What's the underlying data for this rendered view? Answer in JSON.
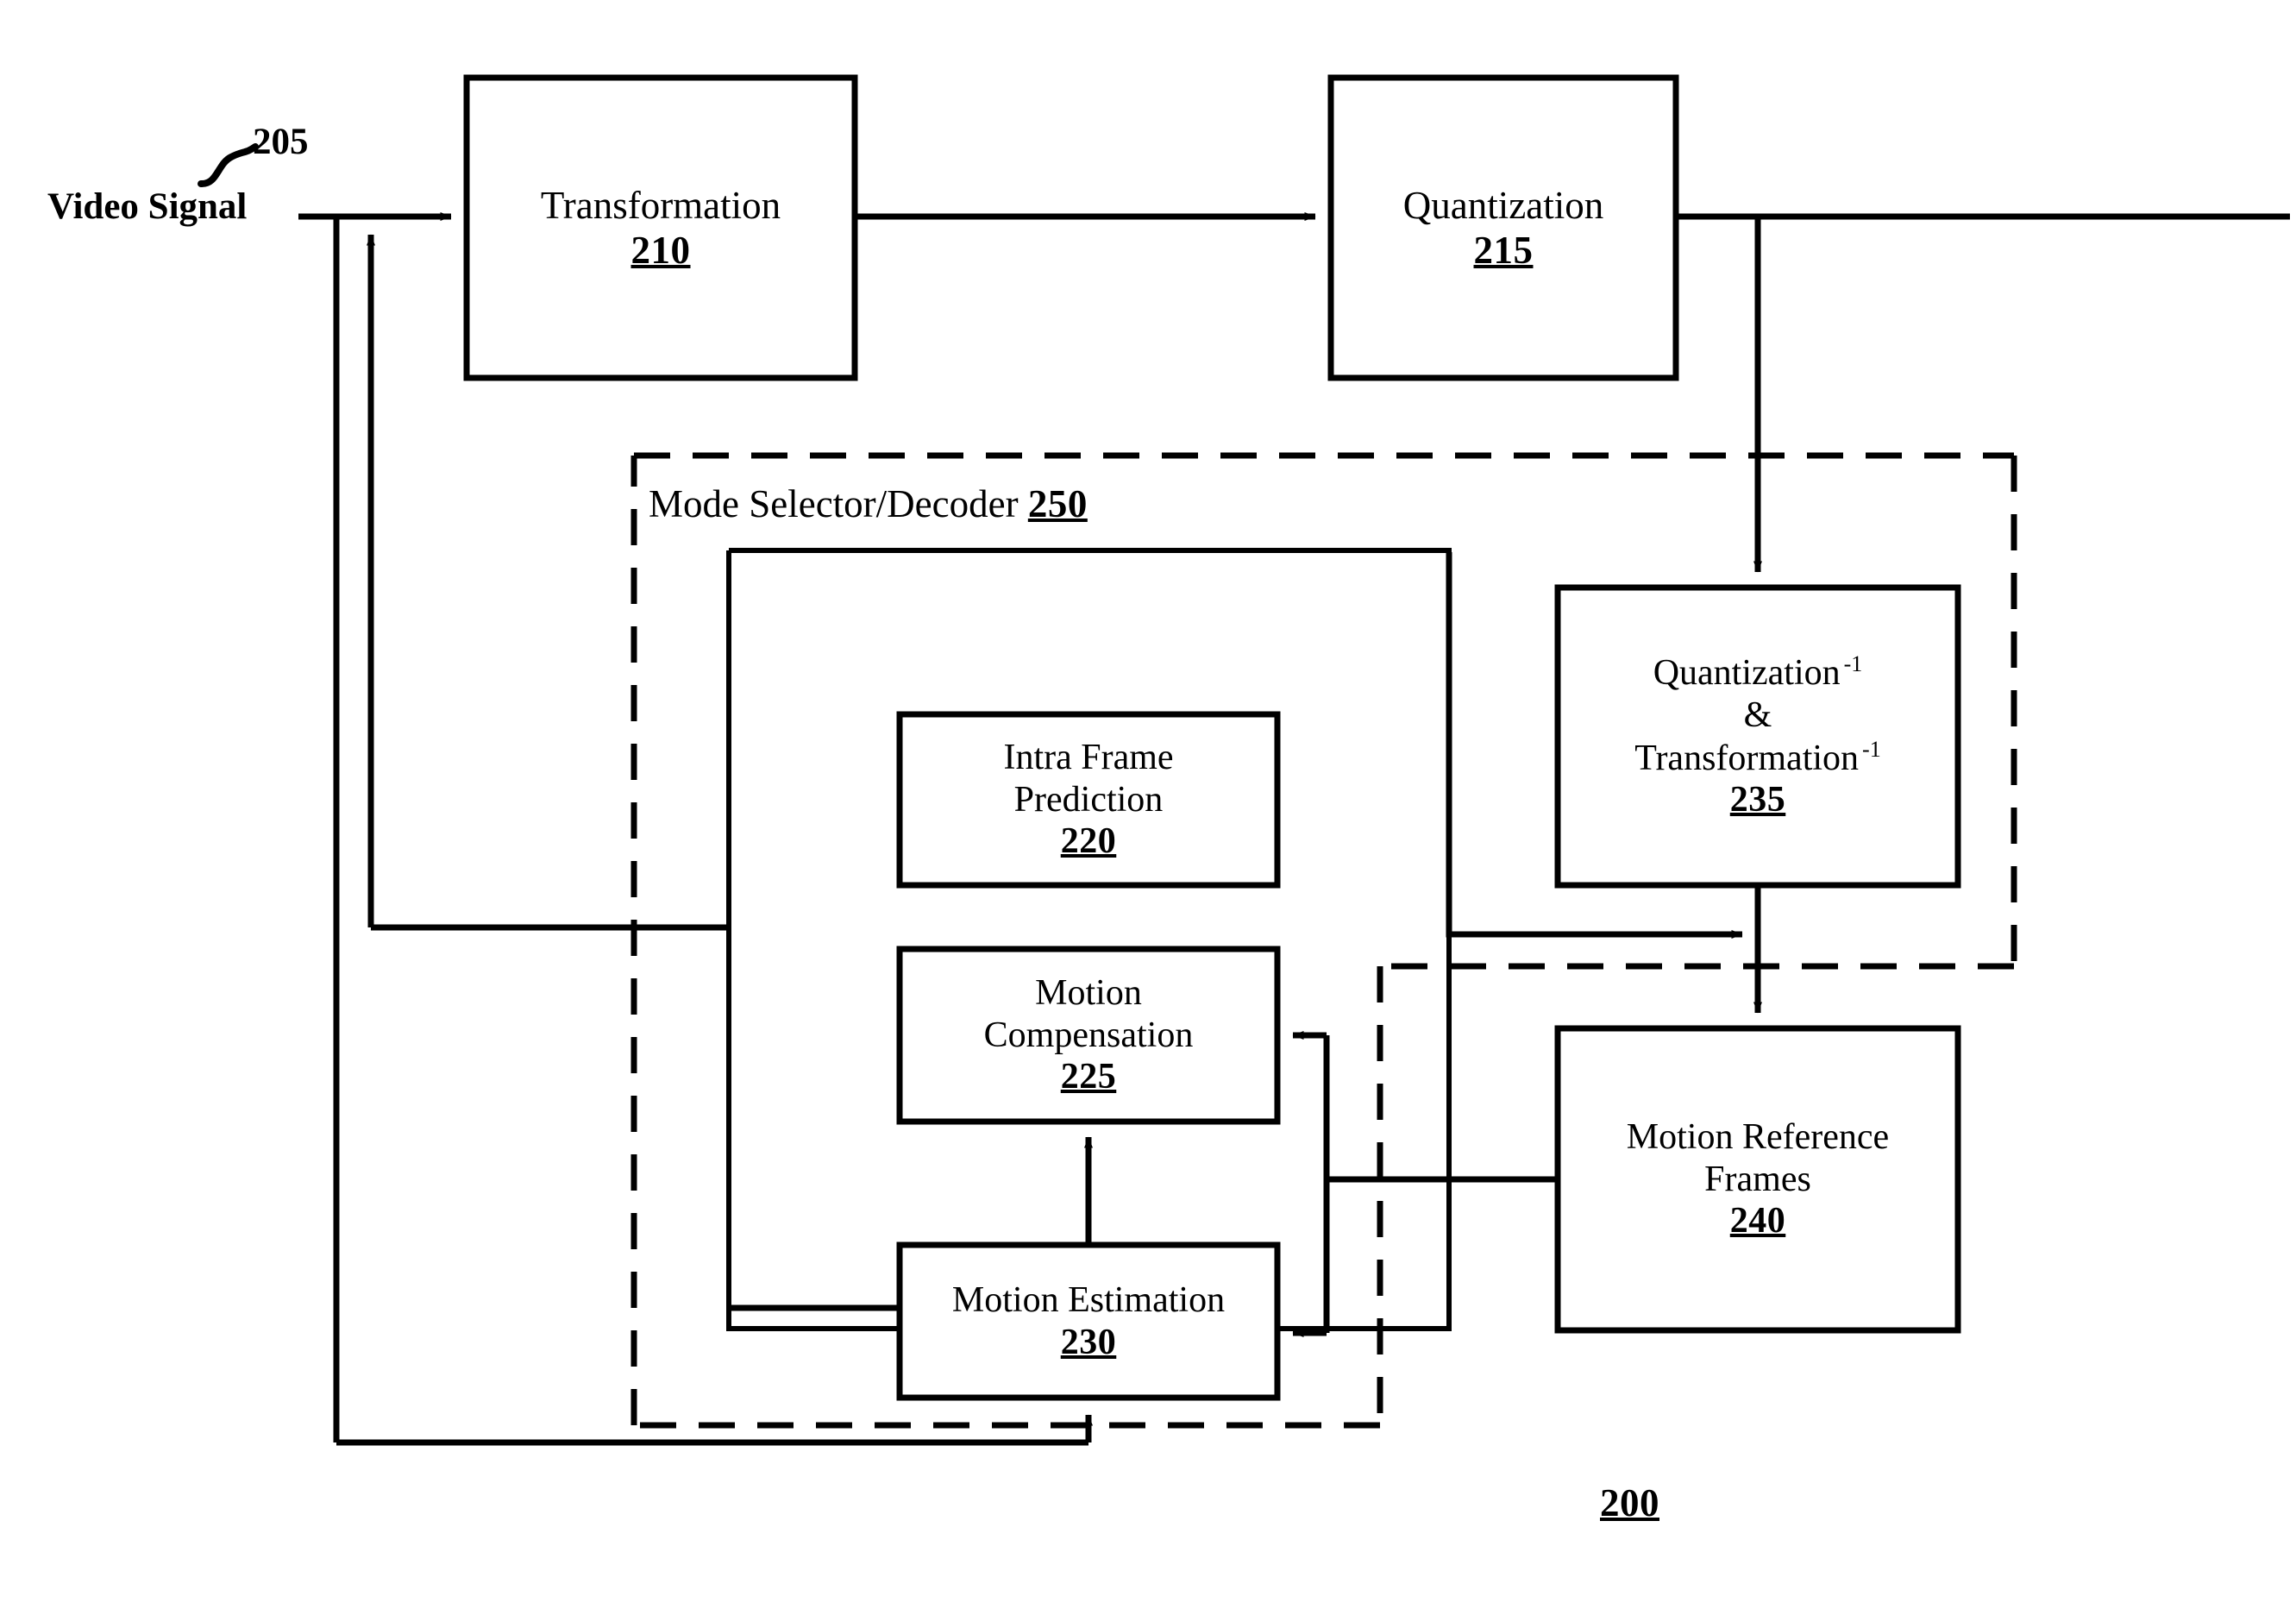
{
  "figure": {
    "figure_ref": "200",
    "signal_label": "Video Signal",
    "signal_ref": "205",
    "container_label": "Mode Selector/Decoder",
    "container_ref": "250"
  },
  "blocks": {
    "transformation": {
      "line1": "Transformation",
      "ref": "210"
    },
    "quantization": {
      "line1": "Quantization",
      "ref": "215"
    },
    "intra_frame_prediction": {
      "line1": "Intra Frame",
      "line2": "Prediction",
      "ref": "220"
    },
    "motion_compensation": {
      "line1": "Motion",
      "line2": "Compensation",
      "ref": "225"
    },
    "motion_estimation": {
      "line1": "Motion Estimation",
      "ref": "230"
    },
    "inverse_quant_transform": {
      "line1": "Quantization",
      "line1_sup": "-1",
      "line2": "&",
      "line3": "Transformation",
      "line3_sup": "-1",
      "ref": "235"
    },
    "motion_reference_frames": {
      "line1": "Motion Reference",
      "line2": "Frames",
      "ref": "240"
    }
  },
  "colors": {
    "ink": "#000000",
    "paper": "#ffffff"
  }
}
